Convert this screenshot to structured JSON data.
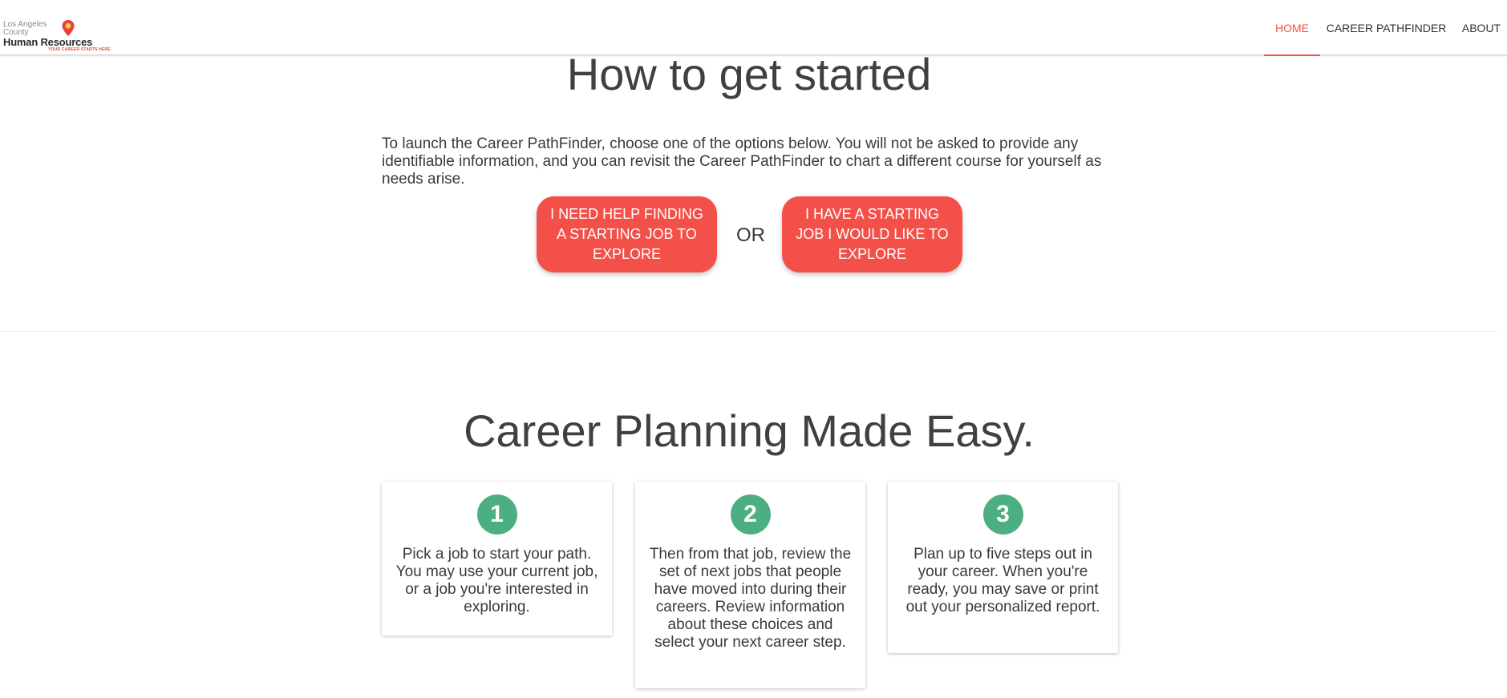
{
  "logo": {
    "line1": "Los Angeles",
    "line2": "County",
    "line3": "Human Resources",
    "tagline": "YOUR CAREER STARTS HERE"
  },
  "nav": {
    "items": [
      {
        "label": "HOME",
        "active": true
      },
      {
        "label": "CAREER PATHFINDER",
        "active": false
      },
      {
        "label": "ABOUT",
        "active": false
      }
    ]
  },
  "start": {
    "title": "How to get started",
    "intro": "To launch the Career PathFinder, choose one of the options below. You will not be asked to provide any identifiable information, and you can revisit the Career PathFinder to chart a different course for yourself as needs arise.",
    "button_help": "I NEED HELP FINDING A STARTING JOB TO EXPLORE",
    "or_label": "OR",
    "button_have": "I HAVE A STARTING JOB I WOULD LIKE TO EXPLORE"
  },
  "planning": {
    "title": "Career Planning Made Easy.",
    "steps": [
      {
        "number": "1",
        "text": "Pick a job to start your path. You may use your current job, or a job you're interested in exploring."
      },
      {
        "number": "2",
        "text": "Then from that job, review the set of next jobs that people have moved into during their careers. Review information about these choices and select your next career step."
      },
      {
        "number": "3",
        "text": "Plan up to five steps out in your career. When you're ready, you may save or print out your personalized report."
      }
    ]
  },
  "colors": {
    "accent": "#f4504a",
    "step_circle": "#4caf84",
    "text": "#3f3f3f"
  }
}
